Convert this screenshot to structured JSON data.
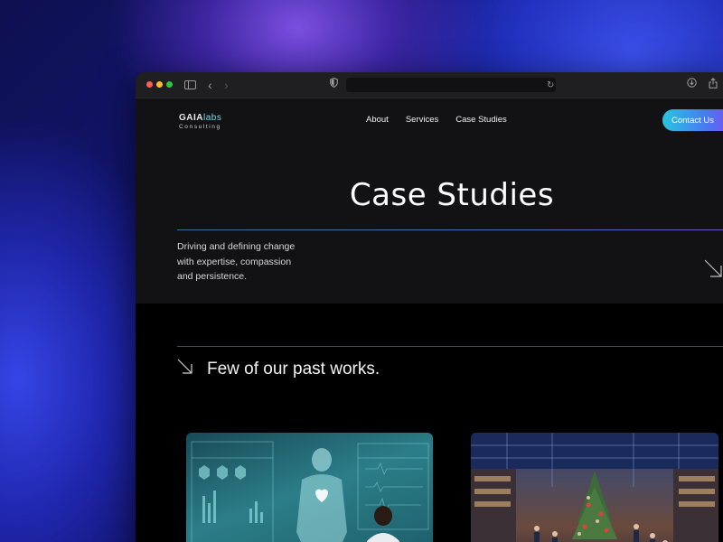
{
  "site": {
    "logo": {
      "main": "GAIA",
      "accent": "labs",
      "sub": "Consulting"
    },
    "nav": [
      {
        "label": "About"
      },
      {
        "label": "Services"
      },
      {
        "label": "Case Studies"
      }
    ],
    "contact_label": "Contact Us"
  },
  "hero": {
    "title": "Case Studies",
    "tagline_lines": [
      "Driving and defining change",
      "with expertise, compassion",
      "and persistence."
    ]
  },
  "works": {
    "title": "Few of our past works.",
    "cards": [
      {
        "image": "healthcare-hologram-image"
      },
      {
        "image": "retail-store-image"
      }
    ]
  },
  "icons": {
    "shield": "shield-icon",
    "reload": "reload-icon",
    "download": "download-icon",
    "share": "share-icon"
  },
  "colors": {
    "accent_gradient": [
      "#28c4e0",
      "#4a78f0",
      "#9a3af0"
    ],
    "page_bg": "#000000",
    "hero_bg": "#121214"
  }
}
